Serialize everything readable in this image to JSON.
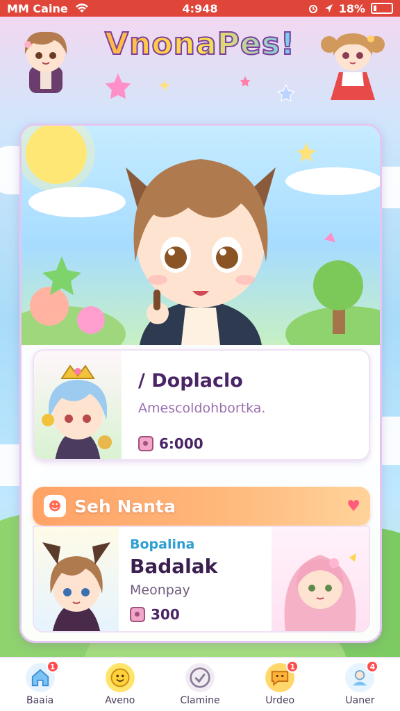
{
  "status_bar": {
    "carrier": "MM Caine",
    "time": "4:948",
    "battery": "18%",
    "battery_level": 0.18
  },
  "app": {
    "title": "VnonaPes!",
    "colors": {
      "status": "#e0453a",
      "title_outline": "#7b3fa0",
      "banner": "#ffa266",
      "badge": "#ff4b4b"
    }
  },
  "profile_card": {
    "name": "/ Doplaclo",
    "subtitle": "Amescoldohbortka.",
    "price_icon": "tag-icon",
    "price": "6:000"
  },
  "section_banner": {
    "icon": "chat-face-icon",
    "label": "Seh Nanta",
    "action_icon": "heart-icon"
  },
  "listing": {
    "category": "Bopalina",
    "name": "Badalak",
    "subtitle": "Meonpay",
    "price_icon": "tag-icon",
    "price": "300"
  },
  "bottom_nav": [
    {
      "label": "Baaia",
      "icon": "home-icon",
      "badge": "1"
    },
    {
      "label": "Aveno",
      "icon": "smile-icon",
      "badge": ""
    },
    {
      "label": "Clamine",
      "icon": "check-circle-icon",
      "badge": ""
    },
    {
      "label": "Urdeo",
      "icon": "chat-icon",
      "badge": "1"
    },
    {
      "label": "Uaner",
      "icon": "profile-icon",
      "badge": "4"
    }
  ]
}
